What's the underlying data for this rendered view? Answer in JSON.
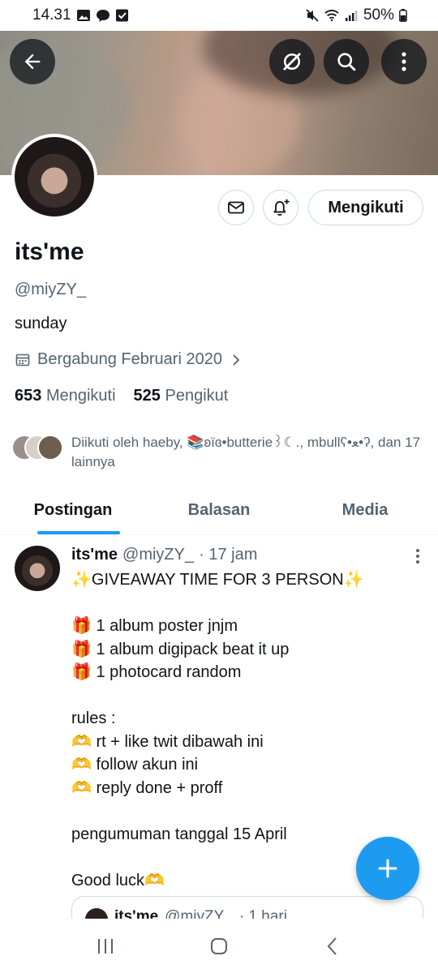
{
  "status_bar": {
    "time": "14.31",
    "battery": "50%"
  },
  "profile": {
    "name": "its'me",
    "handle": "@miyZY_",
    "bio": "sunday",
    "joined": "Bergabung Februari 2020",
    "following_count": "653",
    "following_label": "Mengikuti",
    "followers_count": "525",
    "followers_label": "Pengikut",
    "followed_by": "Diikuti oleh haeby, 📚ʚïɞ•butterie꒱☾., mbullʕ•ﻌ•ʔ, dan 17 lainnya",
    "follow_button": "Mengikuti"
  },
  "tabs": [
    {
      "label": "Postingan",
      "active": true
    },
    {
      "label": "Balasan",
      "active": false
    },
    {
      "label": "Media",
      "active": false
    }
  ],
  "post": {
    "author": "its'me",
    "handle": "@miyZY_",
    "time": "· 17 jam",
    "lines": [
      "✨GIVEAWAY TIME FOR 3 PERSON✨",
      "",
      "🎁 1 album poster jnjm",
      "🎁 1 album digipack beat it up",
      "🎁 1 photocard random",
      "",
      "rules :",
      "🫶 rt + like twit dibawah ini",
      "🫶 follow akun ini",
      "🫶 reply done + proff",
      "",
      "pengumuman tanggal 15 April",
      "",
      "Good luck🫶"
    ],
    "quote": {
      "author": "its'me",
      "handle": "@miyZY_",
      "time": "· 1 hari"
    }
  },
  "icons": {
    "back": "back-arrow-icon",
    "grok": "grok-icon",
    "search": "search-icon",
    "more": "more-vertical-icon",
    "message": "envelope-icon",
    "notify": "bell-plus-icon",
    "calendar": "calendar-icon",
    "compose": "plus-icon"
  },
  "colors": {
    "accent": "#1d9bf0",
    "text": "#0f1419",
    "muted": "#536471",
    "border": "#cfd9de"
  }
}
